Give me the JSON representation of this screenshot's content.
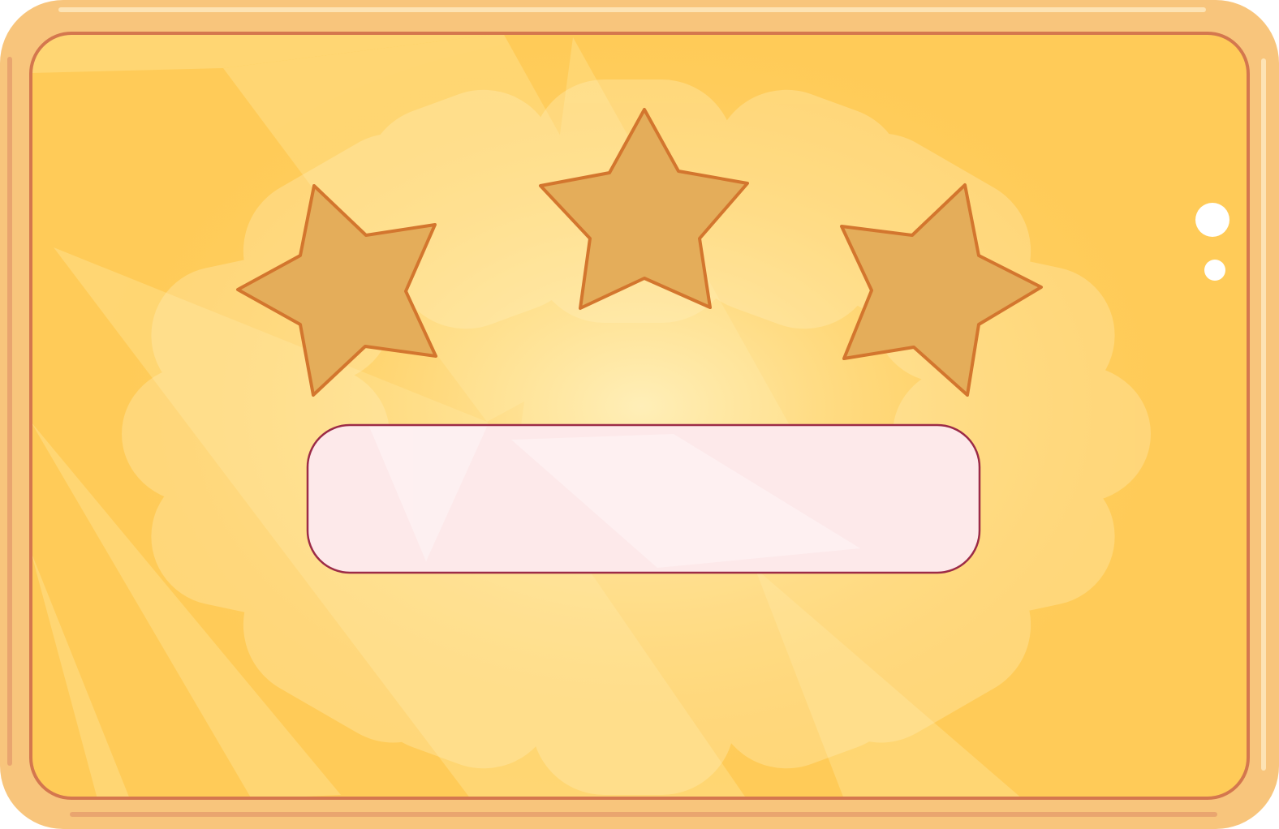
{
  "panel": {
    "frame_color": "#f8c57c",
    "frame_border_color": "#d4774e",
    "background_color": "#ffcb58",
    "rays_color": "#ffe08a"
  },
  "stars": {
    "rating": 0,
    "max": 3,
    "fill_color": "#e4ad5a",
    "stroke_color": "#d3762e"
  },
  "result_box": {
    "text": "",
    "fill_color": "#fde9ea",
    "border_color": "#9c2b47"
  },
  "decorations": {
    "sparkle_color": "#ffffff"
  }
}
